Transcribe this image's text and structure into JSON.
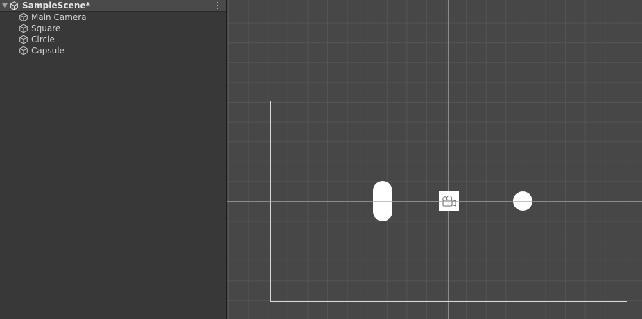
{
  "hierarchy": {
    "scene_name": "SampleScene*",
    "scene_icon": "unity-logo-icon",
    "menu_icon": "kebab-menu-icon",
    "items": [
      {
        "label": "Main Camera",
        "icon": "cube-icon"
      },
      {
        "label": "Square",
        "icon": "cube-icon"
      },
      {
        "label": "Circle",
        "icon": "cube-icon"
      },
      {
        "label": "Capsule",
        "icon": "cube-icon"
      }
    ]
  },
  "scene_view": {
    "grid": true,
    "background_color": "#474747",
    "camera_frame_color": "#d8d8d8",
    "sprite_color": "#ffffff",
    "camera_gizmo_icon": "camera-gizmo-icon",
    "objects": [
      "Capsule",
      "Square",
      "Circle"
    ]
  }
}
